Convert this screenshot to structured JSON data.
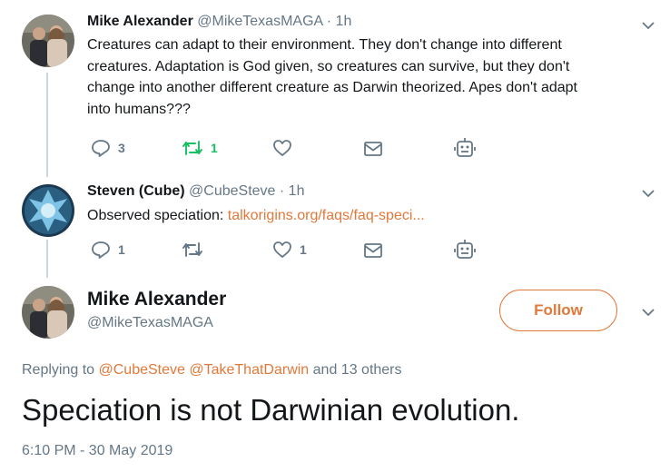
{
  "colors": {
    "accent": "#e0793a",
    "muted": "#657786",
    "retweet_active": "#17bf63",
    "thread_line": "#ccd6dd"
  },
  "tweet1": {
    "name": "Mike Alexander",
    "handle": "@MikeTexasMAGA",
    "separator": "·",
    "time": "1h",
    "text_lines": [
      "Creatures can adapt to their environment. They don't change into different",
      "creatures. Adaptation is God given, so creatures can survive, but they don't",
      "change into another different creature as Darwin theorized. Apes don't adapt",
      "into humans???"
    ],
    "replies": "3",
    "retweets": "1",
    "likes": ""
  },
  "tweet2": {
    "name": "Steven (Cube)",
    "handle": "@CubeSteve",
    "separator": "·",
    "time": "1h",
    "text_prefix": "Observed speciation: ",
    "link_text": "talkorigins.org/faqs/faq-speci...",
    "replies": "1",
    "retweets": "",
    "likes": "1"
  },
  "main_tweet": {
    "name": "Mike Alexander",
    "handle": "@MikeTexasMAGA",
    "follow_label": "Follow",
    "replying_prefix": "Replying to",
    "replying_user1": "@CubeSteve",
    "replying_user2": "@TakeThatDarwin",
    "replying_suffix": "and 13 others",
    "text": "Speciation is not Darwinian evolution.",
    "timestamp": "6:10 PM - 30 May 2019"
  },
  "icons": {
    "reply": "reply-icon",
    "retweet": "retweet-icon",
    "like": "heart-icon",
    "dm": "envelope-icon",
    "bot": "robot-icon",
    "caret": "chevron-down-icon"
  }
}
